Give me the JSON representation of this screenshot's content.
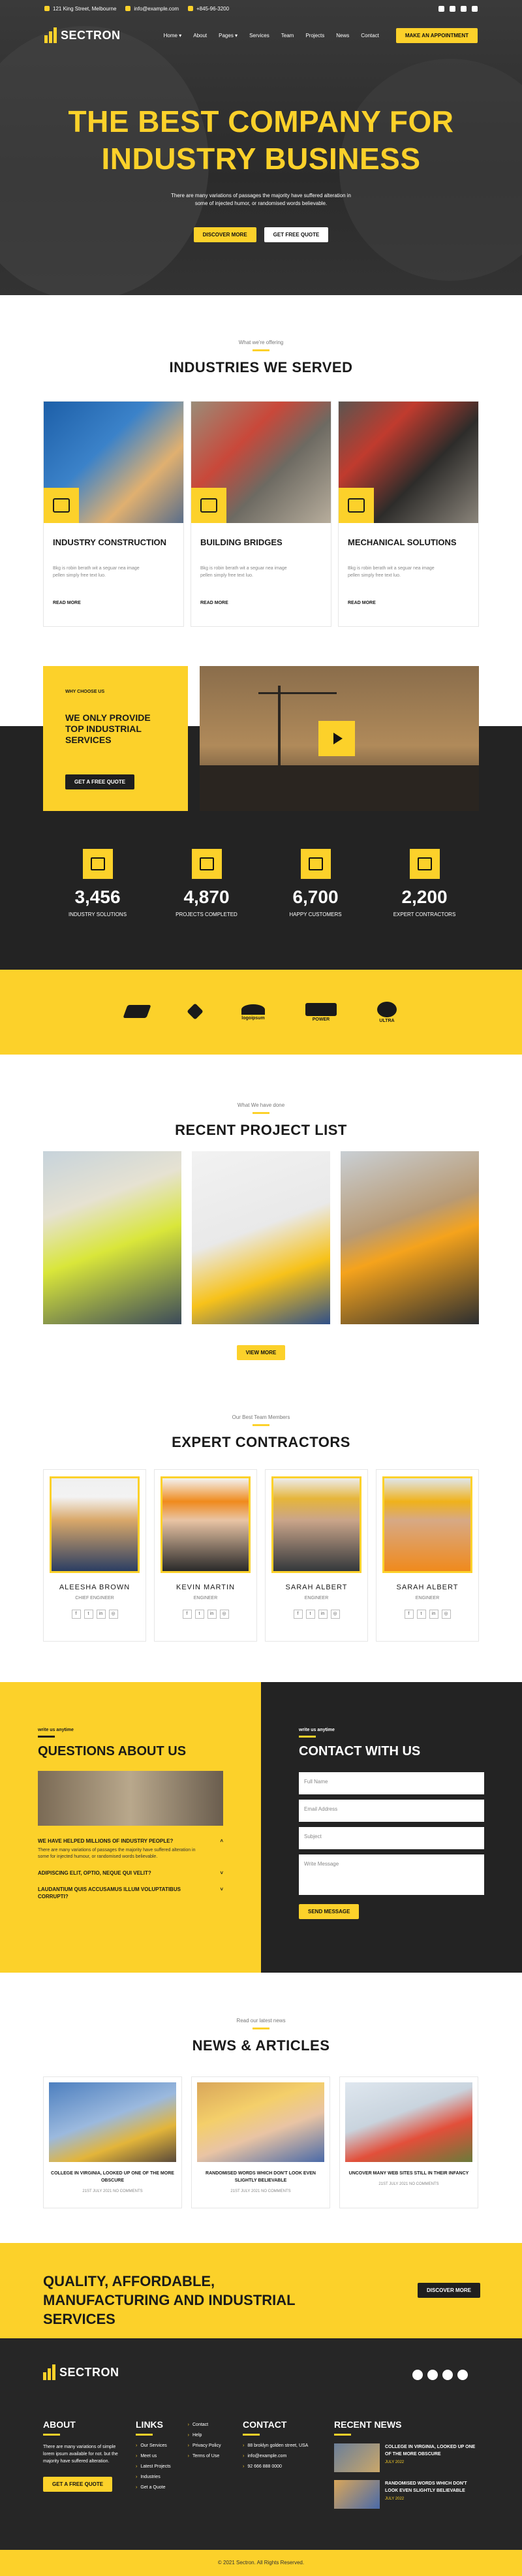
{
  "colors": {
    "accent": "#fcd12a",
    "dark": "#232323",
    "text": "#1a1a1a"
  },
  "topbar": {
    "address": "121 King Street, Melbourne",
    "email": "info@example.com",
    "phone": "+845-96-3200",
    "social_icons": [
      "facebook-icon",
      "twitter-icon",
      "youtube-icon",
      "instagram-icon"
    ]
  },
  "brand": {
    "name": "SECTRON"
  },
  "nav": {
    "items": [
      "Home ▾",
      "About",
      "Pages ▾",
      "Services",
      "Team",
      "Projects",
      "News",
      "Contact"
    ],
    "cta": "MAKE AN APPOINTMENT"
  },
  "hero": {
    "title_line1": "THE BEST COMPANY FOR",
    "title_line2": "INDUSTRY BUSINESS",
    "subtitle": "There are many variations of passages the majority have suffered alteration in some of injected humor, or randomised words believable.",
    "btn_primary": "DISCOVER MORE",
    "btn_secondary": "GET FREE QUOTE"
  },
  "services": {
    "small": "What we're offering",
    "title": "INDUSTRIES WE SERVED",
    "items": [
      {
        "title": "INDUSTRY CONSTRUCTION",
        "text": "Bkg is robin berath wit a seguar nea image pellen simply free text luo.",
        "more": "READ MORE"
      },
      {
        "title": "BUILDING BRIDGES",
        "text": "Bkg is robin berath wit a seguar nea image pellen simply free text luo.",
        "more": "READ MORE"
      },
      {
        "title": "MECHANICAL SOLUTIONS",
        "text": "Bkg is robin berath wit a seguar nea image pellen simply free text luo.",
        "more": "READ MORE"
      }
    ]
  },
  "why": {
    "small": "WHY CHOOSE US",
    "title": "WE ONLY PROVIDE TOP INDUSTRIAL SERVICES",
    "btn": "GET A FREE QUOTE"
  },
  "stats": [
    {
      "num": "3,456",
      "label": "INDUSTRY SOLUTIONS"
    },
    {
      "num": "4,870",
      "label": "PROJECTS COMPLETED"
    },
    {
      "num": "6,700",
      "label": "HAPPY CUSTOMERS"
    },
    {
      "num": "2,200",
      "label": "EXPERT CONTRACTORS"
    }
  ],
  "clients": [
    "",
    "",
    "logoipsum",
    "POWER",
    "ULTRA"
  ],
  "projects": {
    "small": "What We have done",
    "title": "RECENT PROJECT LIST",
    "btn": "VIEW MORE"
  },
  "team": {
    "small": "Our Best Team Members",
    "title": "EXPERT CONTRACTORS",
    "members": [
      {
        "name": "ALEESHA BROWN",
        "role": "CHIEF ENGINEER"
      },
      {
        "name": "KEVIN MARTIN",
        "role": "ENGINEER"
      },
      {
        "name": "SARAH ALBERT",
        "role": "ENGINEER"
      },
      {
        "name": "SARAH ALBERT",
        "role": "ENGINEER"
      }
    ]
  },
  "faq": {
    "small": "write us anytime",
    "title": "QUESTIONS ABOUT US",
    "items": [
      {
        "q": "WE HAVE HELPED MILLIONS OF INDUSTRY PEOPLE?",
        "a": "There are many variations of passages the majority have suffered alteration in some for injected humour, or randomised words believable."
      },
      {
        "q": "ADIPISCING ELIT, OPTIO, NEQUE QUI VELIT?",
        "a": ""
      },
      {
        "q": "LAUDANTIUM QUIS ACCUSAMUS ILLUM VOLUPTATIBUS CORRUPTI?",
        "a": ""
      }
    ]
  },
  "contact": {
    "small": "write us anytime",
    "title": "CONTACT WITH US",
    "fields": {
      "name": "Full Name",
      "email": "Email Address",
      "subject": "Subject",
      "message": "Write Message"
    },
    "btn": "SEND MESSAGE"
  },
  "news": {
    "small": "Read our latest news",
    "title": "NEWS & ARTICLES",
    "items": [
      {
        "title": "COLLEGE IN VIRGINIA, LOOKED UP ONE OF THE MORE OBSCURE",
        "date": "21ST JULY 2021  NO COMMENTS"
      },
      {
        "title": "RANDOMISED WORDS WHICH DON'T LOOK EVEN SLIGHTLY BELIEVABLE",
        "date": "21ST JULY 2021  NO COMMENTS"
      },
      {
        "title": "UNCOVER MANY WEB SITES STILL IN THEIR INFANCY",
        "date": "21ST JULY 2021  NO COMMENTS"
      }
    ]
  },
  "cta": {
    "title": "QUALITY, AFFORDABLE, MANUFACTURING AND INDUSTRIAL SERVICES",
    "btn": "DISCOVER MORE"
  },
  "footer": {
    "about_title": "ABOUT",
    "about_text": "There are many variations of simple lorem ipsum available for not. but the majority have suffered alteration.",
    "about_btn": "GET A FREE QUOTE",
    "links_title": "LINKS",
    "links1": [
      "Our Services",
      "Meet us",
      "Latest Projects",
      "Industries",
      "Get a Quote"
    ],
    "links2": [
      "Contact",
      "Help",
      "Privacy Policy",
      "Terms of Use"
    ],
    "contact_title": "CONTACT",
    "contact_items": [
      "88 broklyn golden street, USA",
      "info@example.com",
      "92 666 888 0000"
    ],
    "news_title": "RECENT NEWS",
    "news": [
      {
        "title": "COLLEGE IN VIRGINIA, LOOKED UP ONE OF THE MORE OBSCURE",
        "date": "JULY 2022"
      },
      {
        "title": "RANDOMISED WORDS WHICH DON'T LOOK EVEN SLIGHTLY BELIEVABLE",
        "date": "JULY 2022"
      }
    ],
    "copyright": "© 2021 Sectron. All Rights Reserved."
  }
}
